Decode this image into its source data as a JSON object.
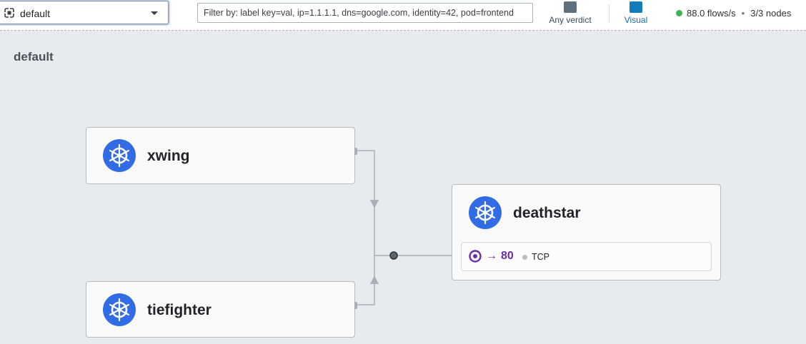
{
  "toolbar": {
    "namespace": "default",
    "filter_placeholder": "Filter by: label key=val, ip=1.1.1.1, dns=google.com, identity=42, pod=frontend",
    "verdict_label": "Any verdict",
    "visual_label": "Visual",
    "flows_rate": "88.0 flows/s",
    "separator": "•",
    "nodes_status": "3/3 nodes"
  },
  "canvas": {
    "namespace_title": "default",
    "services": [
      {
        "name": "xwing",
        "icon": "kubernetes-icon"
      },
      {
        "name": "tiefighter",
        "icon": "kubernetes-icon"
      },
      {
        "name": "deathstar",
        "icon": "kubernetes-icon",
        "ports": [
          {
            "arrow": "→",
            "port": "80",
            "protocol": "TCP"
          }
        ]
      }
    ]
  },
  "colors": {
    "kubernetes_blue": "#326ce5",
    "port_purple": "#6a2ea8",
    "status_green": "#3fb34f",
    "canvas_bg": "#e8ebee",
    "edge_gray": "#a9b0b8"
  }
}
